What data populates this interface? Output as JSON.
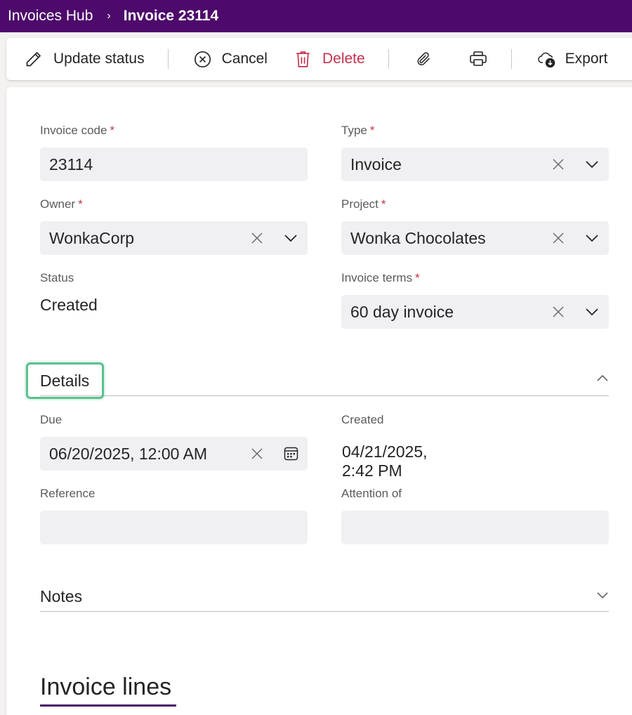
{
  "breadcrumb": {
    "parent": "Invoices Hub",
    "separator": "›",
    "current": "Invoice 23114"
  },
  "toolbar": {
    "update_status": "Update status",
    "cancel": "Cancel",
    "delete": "Delete",
    "export": "Export",
    "icons": [
      "pencil-icon",
      "cancel-circle-icon",
      "trash-icon",
      "paperclip-icon",
      "printer-icon",
      "cloud-download-icon"
    ]
  },
  "form": {
    "invoice_code": {
      "label": "Invoice code",
      "required": "*",
      "value": "23114"
    },
    "type": {
      "label": "Type",
      "required": "*",
      "value": "Invoice"
    },
    "owner": {
      "label": "Owner",
      "required": "*",
      "value": "WonkaCorp"
    },
    "project": {
      "label": "Project",
      "required": "*",
      "value": "Wonka Chocolates"
    },
    "status": {
      "label": "Status",
      "value": "Created"
    },
    "invoice_terms": {
      "label": "Invoice terms",
      "required": "*",
      "value": "60 day invoice"
    }
  },
  "details": {
    "title": "Details",
    "due": {
      "label": "Due",
      "value": "06/20/2025, 12:00 AM"
    },
    "created": {
      "label": "Created",
      "value": "04/21/2025, 2:42 PM"
    },
    "reference": {
      "label": "Reference",
      "value": ""
    },
    "attention_of": {
      "label": "Attention of",
      "value": ""
    }
  },
  "notes": {
    "title": "Notes"
  },
  "invoice_lines": {
    "title": "Invoice lines"
  },
  "colors": {
    "header": "#4d0a6b",
    "danger": "#c4314b",
    "highlight": "#5cc08f",
    "field_bg": "#f0f0f3"
  }
}
